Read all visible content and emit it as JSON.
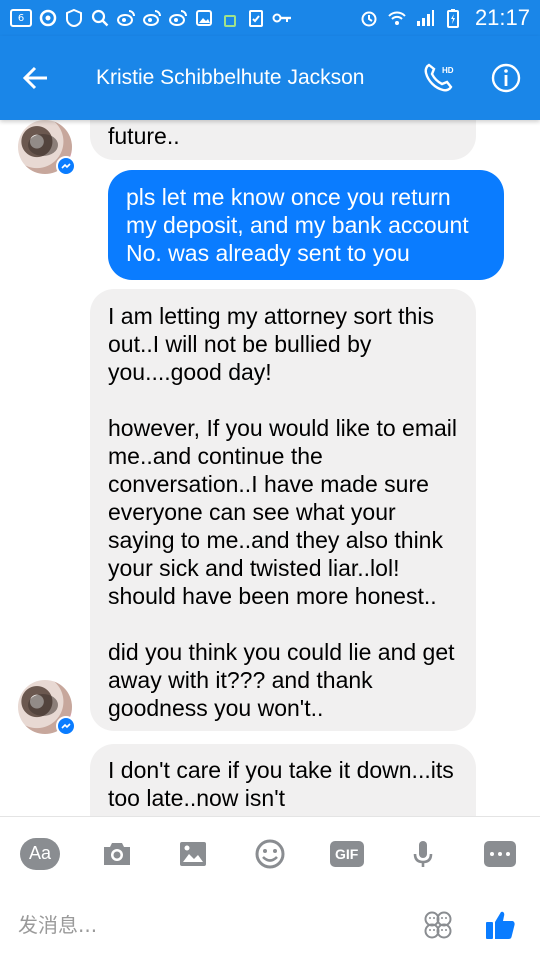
{
  "status_bar": {
    "notification_count": "6",
    "time": "21:17"
  },
  "header": {
    "contact_name": "Kristie Schibbelhute Jackson",
    "call_badge": "HD"
  },
  "messages": [
    {
      "direction": "incoming",
      "paragraphs": [
        "future.."
      ]
    },
    {
      "direction": "outgoing",
      "paragraphs": [
        "pls let me know once you return my deposit, and my bank account No. was already sent to you"
      ]
    },
    {
      "direction": "incoming",
      "paragraphs": [
        "I am letting my attorney sort this out..I will not be bullied by you....good day!",
        "however, If you would like to email me..and continue the conversation..I have made sure everyone can see what your saying to me..and they also think your sick and twisted liar..lol! should have been more honest..",
        "did you think you could lie and get away with it??? and thank goodness you won't.."
      ]
    },
    {
      "direction": "incoming",
      "paragraphs": [
        "I don't care if you take it down...its too late..now isn't"
      ]
    }
  ],
  "toolbar": {
    "aa_label": "Aa",
    "gif_label": "GIF"
  },
  "compose": {
    "placeholder": "发消息..."
  },
  "colors": {
    "header_blue": "#1a86e8",
    "outgoing_bubble": "#0a7cff",
    "incoming_bubble": "#f1f0f0",
    "toolbar_gray": "#8a8d91",
    "like_blue": "#0a7cff"
  },
  "icons": {
    "back": "arrow-left-icon",
    "call": "phone-hd-icon",
    "info": "info-icon",
    "camera": "camera-icon",
    "gallery": "image-icon",
    "emoji": "smiley-icon",
    "mic": "microphone-icon",
    "more": "more-icon",
    "stickers": "emoji-faces-icon",
    "like": "thumbs-up-icon"
  }
}
